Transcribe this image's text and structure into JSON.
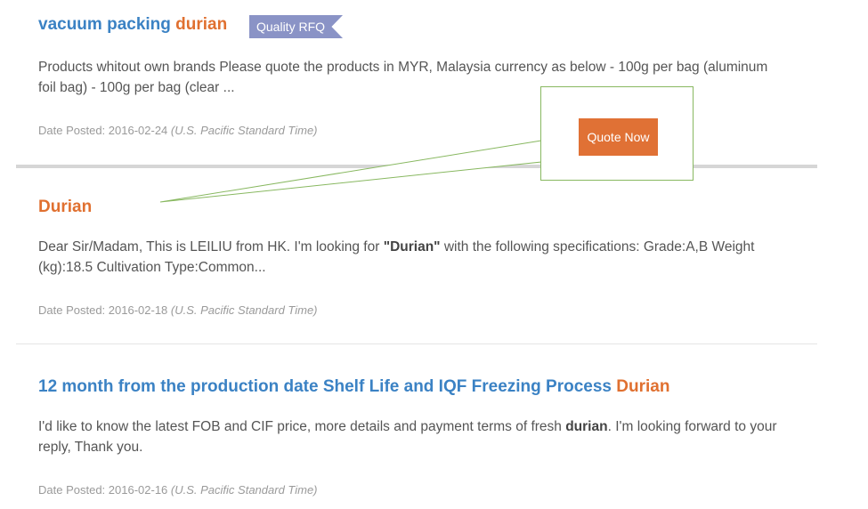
{
  "items": [
    {
      "title_main": "vacuum packing",
      "title_highlight": "durian",
      "tag": "Quality RFQ",
      "desc": "Products whitout own brands Please quote the products in MYR, Malaysia currency as below - 100g per bag (aluminum foil bag) - 100g per bag (clear ...",
      "date_label": "Date Posted:",
      "date": "2016-02-24",
      "tz": "(U.S. Pacific Standard Time)"
    },
    {
      "title_highlight": "Durian",
      "desc_pre": "Dear Sir/Madam, This is LEILIU from HK. I'm looking for ",
      "desc_bold": "\"Durian\"",
      "desc_post": " with the following specifications: Grade:A,B Weight (kg):18.5 Cultivation Type:Common...",
      "date_label": "Date Posted:",
      "date": "2016-02-18",
      "tz": "(U.S. Pacific Standard Time)"
    },
    {
      "title_main": "12 month from the production date Shelf Life and IQF Freezing Process",
      "title_highlight": "Durian",
      "desc_pre": "I'd like to know the latest FOB and CIF price, more details and payment terms of fresh ",
      "desc_bold": "durian",
      "desc_post": ". I'm looking forward to your reply, Thank you.",
      "date_label": "Date Posted:",
      "date": "2016-02-16",
      "tz": "(U.S. Pacific Standard Time)"
    }
  ],
  "callout": {
    "button_label": "Quote Now",
    "border_color": "#88b860",
    "button_color": "#e07135"
  },
  "colors": {
    "link_blue": "#3b82c4",
    "highlight_orange": "#e07030",
    "tag_bg": "#8a93c6"
  }
}
